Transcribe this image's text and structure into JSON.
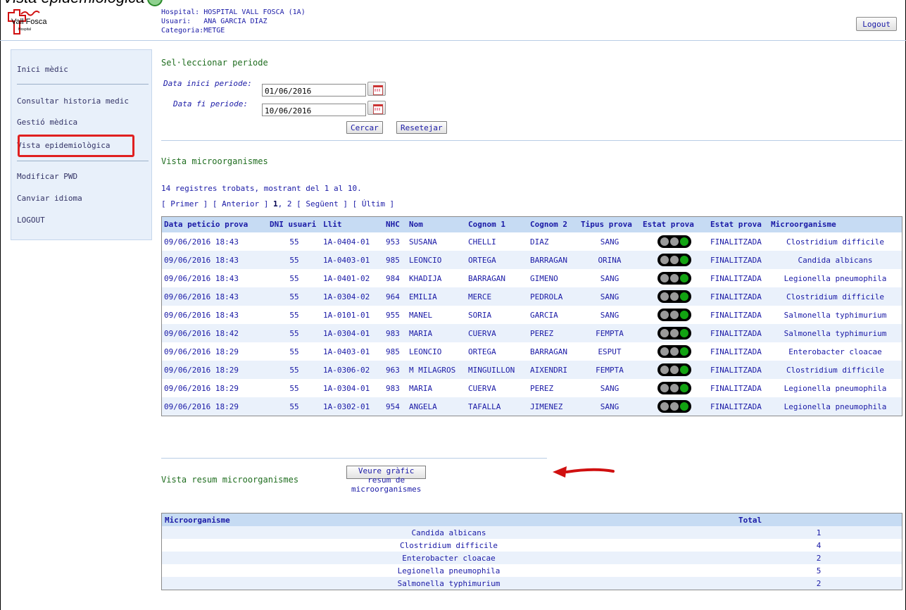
{
  "caption": "Vista epidemiològica",
  "header": {
    "logo_text": "Vall Fosca",
    "logo_sub": "Hospital",
    "hospital_label": "Hospital:",
    "hospital_value": "HOSPITAL VALL FOSCA (1A)",
    "user_label": "Usuari:",
    "user_value": "ANA GARCIA DIAZ",
    "category_label": "Categoria:",
    "category_value": "METGE",
    "logout": "Logout"
  },
  "sidebar": {
    "items": [
      "Inici mèdic",
      "Consultar historia medic",
      "Gestió mèdica",
      "Vista epidemiològica",
      "Modificar PWD",
      "Canviar idioma",
      "LOGOUT"
    ]
  },
  "period": {
    "title": "Sel·leccionar periode",
    "start_label": "Data inici periode:",
    "start_value": "01/06/2016",
    "end_label": "Data fi periode:",
    "end_value": "10/06/2016",
    "search": "Cercar",
    "reset": "Resetejar"
  },
  "micro": {
    "title": "Vista microorganismes",
    "count_text": "14 registres trobats, mostrant del 1 al 10.",
    "pager": {
      "first": "[ Primer ]",
      "prev": "[ Anterior ]",
      "page1": "1",
      "page2": "2",
      "next": "[ Següent ]",
      "last": "[ Últim ]"
    },
    "columns": [
      "Data peticio prova",
      "DNI usuari",
      "Llit",
      "NHC",
      "Nom",
      "Cognom 1",
      "Cognom 2",
      "Tipus prova",
      "Estat prova",
      "Estat prova",
      "Microorganisme"
    ],
    "rows": [
      [
        "09/06/2016 18:43",
        "55",
        "1A-0404-01",
        "953",
        "SUSANA",
        "CHELLI",
        "DIAZ",
        "SANG",
        "FINALITZADA",
        "Clostridium difficile"
      ],
      [
        "09/06/2016 18:43",
        "55",
        "1A-0403-01",
        "985",
        "LEONCIO",
        "ORTEGA",
        "BARRAGAN",
        "ORINA",
        "FINALITZADA",
        "Candida albicans"
      ],
      [
        "09/06/2016 18:43",
        "55",
        "1A-0401-02",
        "984",
        "KHADIJA",
        "BARRAGAN",
        "GIMENO",
        "SANG",
        "FINALITZADA",
        "Legionella pneumophila"
      ],
      [
        "09/06/2016 18:43",
        "55",
        "1A-0304-02",
        "964",
        "EMILIA",
        "MERCE",
        "PEDROLA",
        "SANG",
        "FINALITZADA",
        "Clostridium difficile"
      ],
      [
        "09/06/2016 18:43",
        "55",
        "1A-0101-01",
        "955",
        "MANEL",
        "SORIA",
        "GARCIA",
        "SANG",
        "FINALITZADA",
        "Salmonella typhimurium"
      ],
      [
        "09/06/2016 18:42",
        "55",
        "1A-0304-01",
        "983",
        "MARIA",
        "CUERVA",
        "PEREZ",
        "FEMPTA",
        "FINALITZADA",
        "Salmonella typhimurium"
      ],
      [
        "09/06/2016 18:29",
        "55",
        "1A-0403-01",
        "985",
        "LEONCIO",
        "ORTEGA",
        "BARRAGAN",
        "ESPUT",
        "FINALITZADA",
        "Enterobacter cloacae"
      ],
      [
        "09/06/2016 18:29",
        "55",
        "1A-0306-02",
        "963",
        "M MILAGROS",
        "MINGUILLON",
        "AIXENDRI",
        "FEMPTA",
        "FINALITZADA",
        "Clostridium difficile"
      ],
      [
        "09/06/2016 18:29",
        "55",
        "1A-0304-01",
        "983",
        "MARIA",
        "CUERVA",
        "PEREZ",
        "SANG",
        "FINALITZADA",
        "Legionella pneumophila"
      ],
      [
        "09/06/2016 18:29",
        "55",
        "1A-0302-01",
        "954",
        "ANGELA",
        "TAFALLA",
        "JIMENEZ",
        "SANG",
        "FINALITZADA",
        "Legionella pneumophila"
      ]
    ]
  },
  "summary": {
    "title": "Vista resum microorganismes",
    "chart_button": "Veure gràfic resum de microorganismes",
    "columns": [
      "Microorganisme",
      "Total"
    ],
    "rows": [
      [
        "Candida albicans",
        "1"
      ],
      [
        "Clostridium difficile",
        "4"
      ],
      [
        "Enterobacter cloacae",
        "2"
      ],
      [
        "Legionella pneumophila",
        "5"
      ],
      [
        "Salmonella typhimurium",
        "2"
      ]
    ]
  },
  "colors": {
    "accent_blue": "#1a1aa6",
    "header_blue": "#c6dbf3",
    "title_green": "#1f6d1f",
    "highlight_red": "#e02020",
    "light_green": "#12a312"
  }
}
